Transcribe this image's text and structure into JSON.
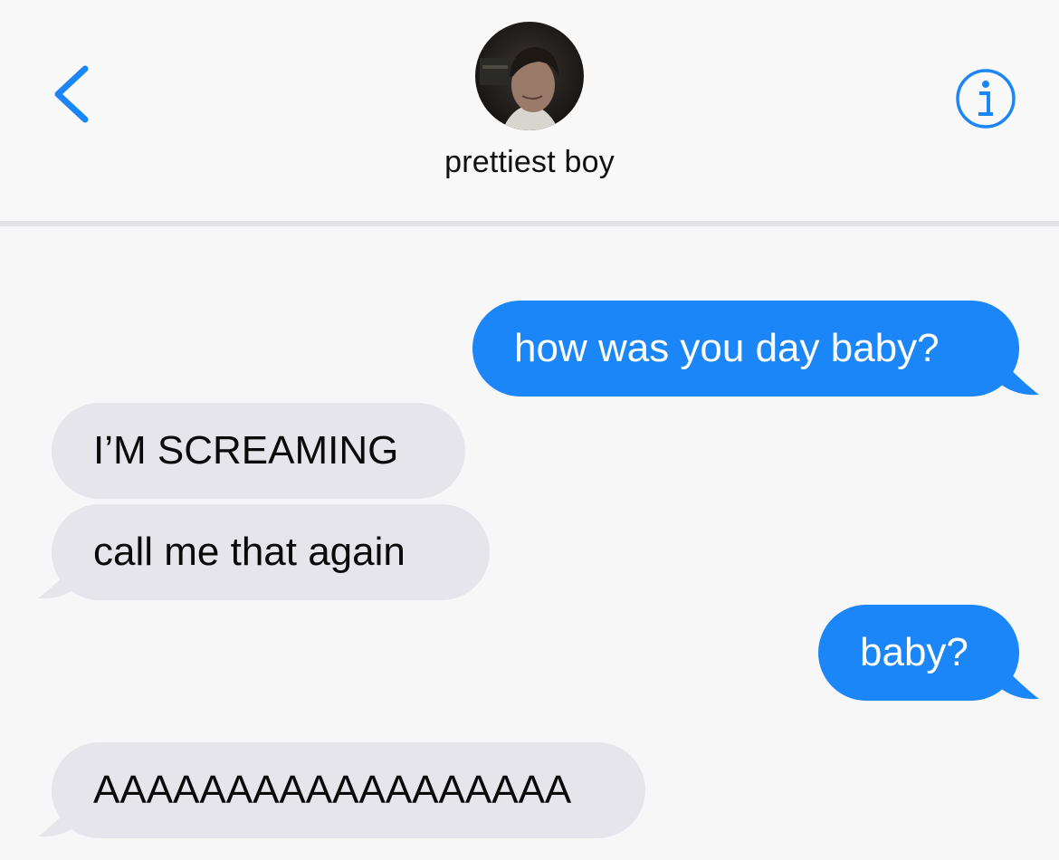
{
  "header": {
    "contact_name": "prettiest boy",
    "back_icon": "chevron-left-icon",
    "info_icon": "info-circle-icon",
    "accent_color": "#1b86f8"
  },
  "messages": [
    {
      "direction": "sent",
      "text": "how was you day baby?"
    },
    {
      "direction": "received",
      "text": "I’M SCREAMING"
    },
    {
      "direction": "received",
      "text": "call me that again"
    },
    {
      "direction": "sent",
      "text": "baby?"
    },
    {
      "direction": "received",
      "text": "AAAAAAAAAAAAAAAAAA"
    }
  ],
  "colors": {
    "sent_bubble": "#1b86f8",
    "received_bubble": "#e6e5eb",
    "background": "#f7f7f7"
  }
}
